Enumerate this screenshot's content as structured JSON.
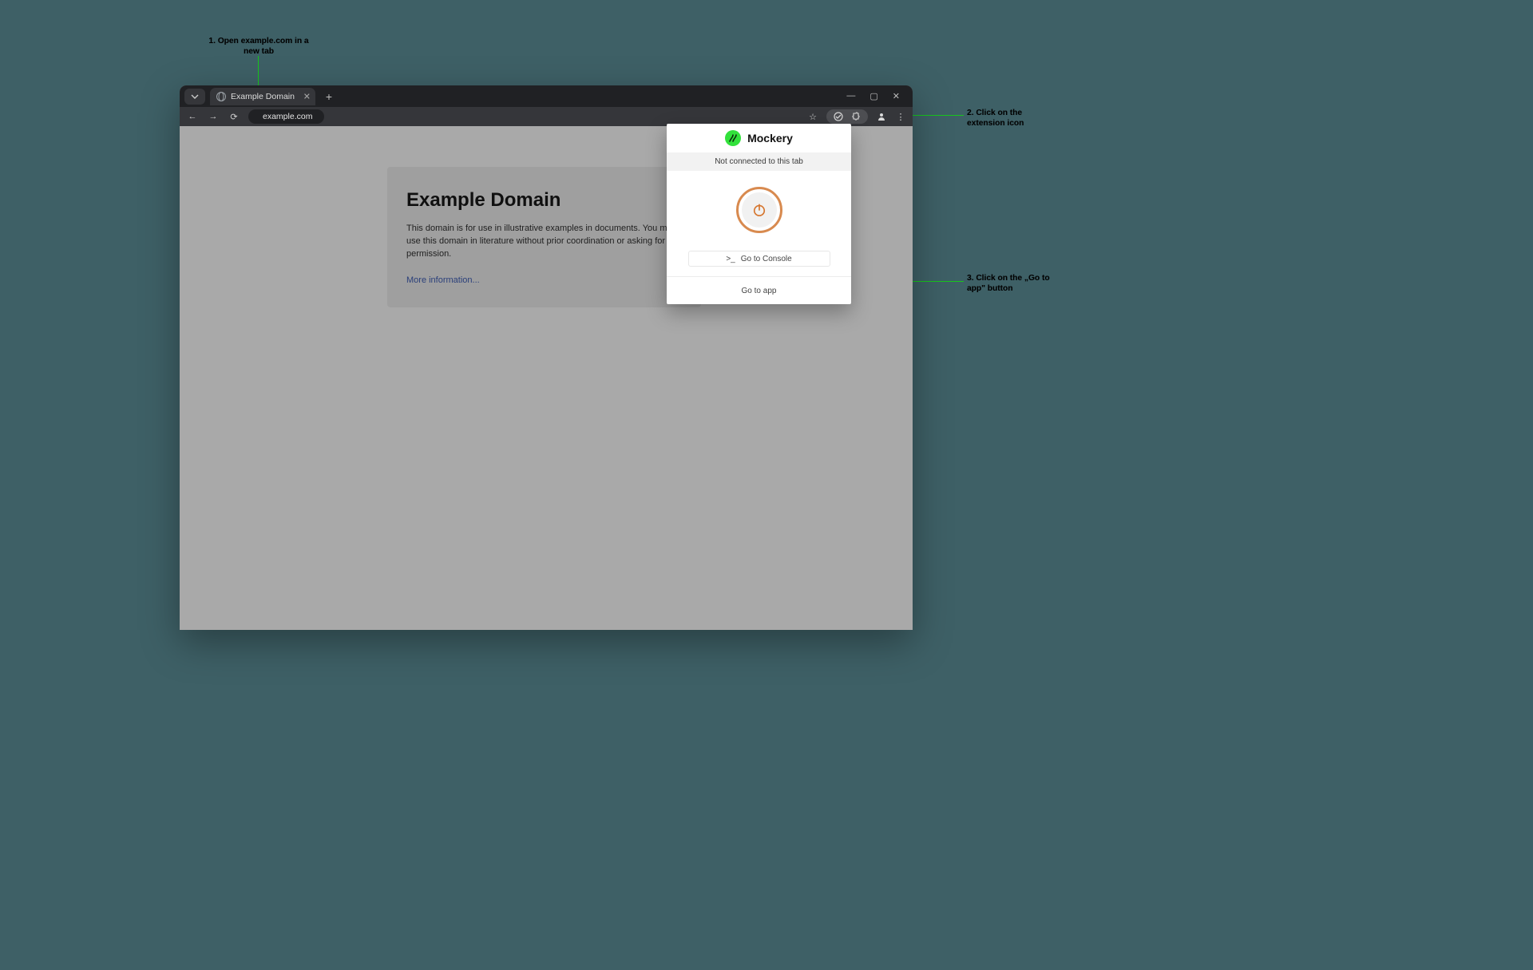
{
  "annotations": {
    "step1": "1. Open example.com in a new tab",
    "step2": "2. Click on the extension icon",
    "step3": "3. Click on the „Go to app\" button"
  },
  "browser": {
    "tab_title": "Example Domain",
    "address": "example.com"
  },
  "page": {
    "heading": "Example Domain",
    "paragraph": "This domain is for use in illustrative examples in documents. You may use this domain in literature without prior coordination or asking for permission.",
    "link": "More information..."
  },
  "popup": {
    "brand": "Mockery",
    "status": "Not connected to this tab",
    "console_prefix": ">_",
    "console_label": "Go to Console",
    "footer_link": "Go to app"
  }
}
